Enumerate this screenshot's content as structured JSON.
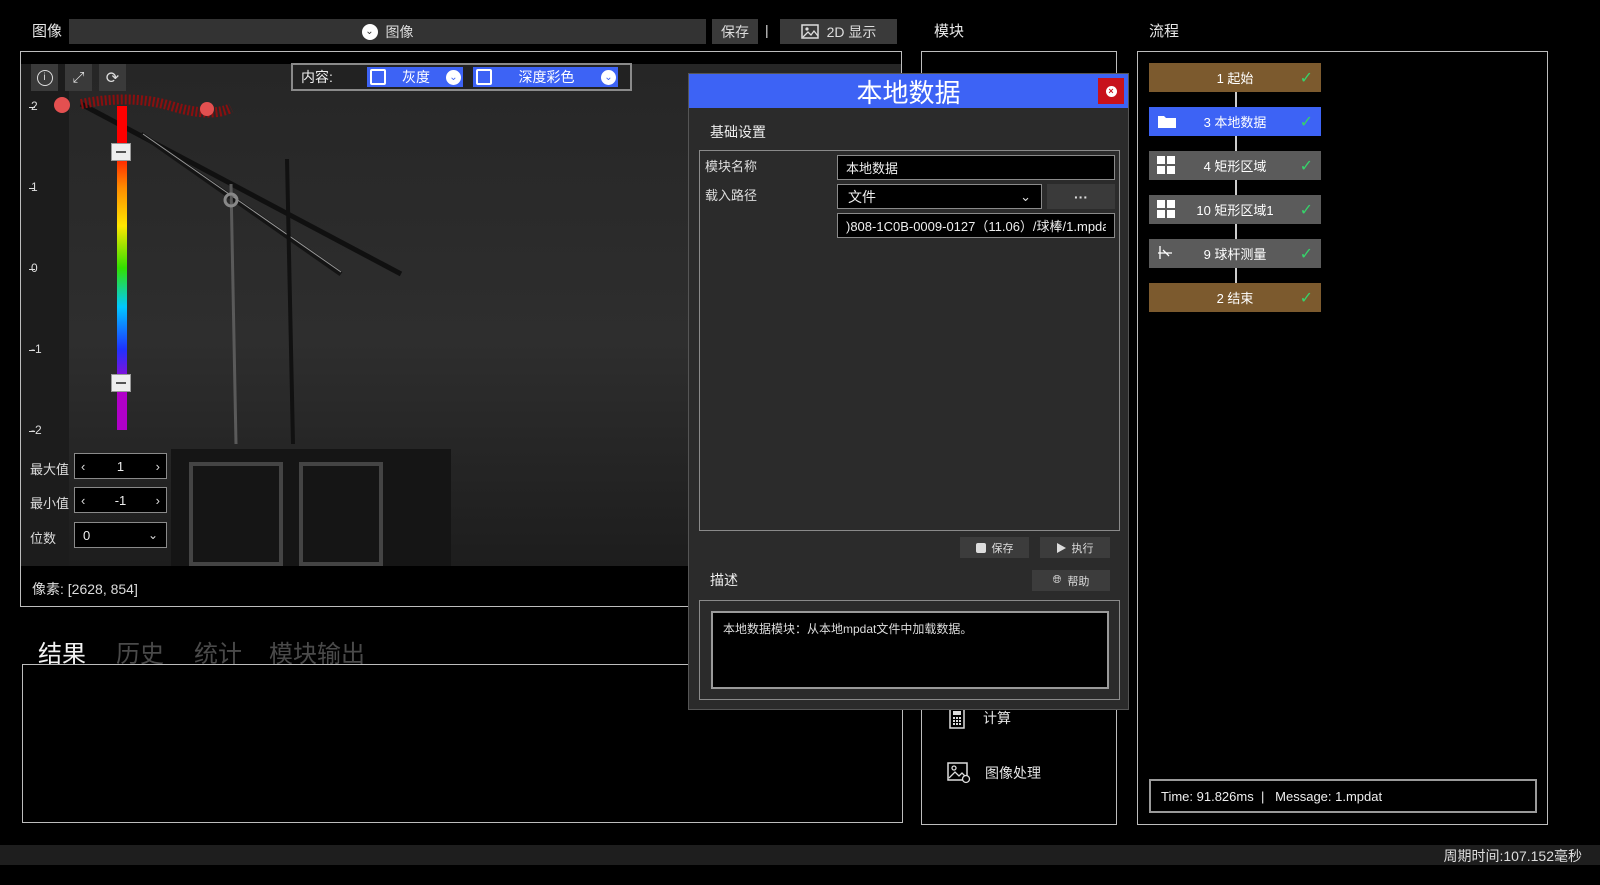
{
  "image_header": {
    "title": "图像",
    "source_select": "图像",
    "save": "保存",
    "separator": "|",
    "display_mode": "2D 显示"
  },
  "module_header": {
    "title": "模块"
  },
  "flow_header": {
    "title": "流程"
  },
  "viewer": {
    "content_label": "内容:",
    "gray_option": "灰度",
    "depth_option": "深度彩色",
    "scale_ticks": [
      "2",
      "1",
      "0",
      "-1",
      "-2"
    ],
    "max_label": "最大值",
    "max_value": "1",
    "min_label": "最小值",
    "min_value": "-1",
    "digits_label": "位数",
    "digits_value": "0",
    "pixel_info": "像素: [2628, 854]"
  },
  "tabs": [
    "结果",
    "历史",
    "统计",
    "模块输出"
  ],
  "dialog": {
    "title": "本地数据",
    "section_basic": "基础设置",
    "module_name_label": "模块名称",
    "module_name_value": "本地数据",
    "load_path_label": "载入路径",
    "load_source": "文件",
    "browse": "···",
    "path_value": ")808-1C0B-0009-0127（11.06）/球棒/1.mpdat",
    "save": "保存",
    "run": "执行",
    "section_desc": "描述",
    "help": "帮助",
    "description": "本地数据模块：从本地mpdat文件中加载数据。"
  },
  "modules": [
    {
      "label": "计算",
      "icon": "calculator-icon"
    },
    {
      "label": "图像处理",
      "icon": "image-processing-icon"
    }
  ],
  "flow": {
    "nodes": [
      {
        "label": "1 起始",
        "kind": "start",
        "status": "ok"
      },
      {
        "label": "3 本地数据",
        "kind": "selected",
        "status": "ok"
      },
      {
        "label": "4 矩形区域",
        "kind": "module",
        "status": "ok"
      },
      {
        "label": "10 矩形区域1",
        "kind": "module",
        "status": "ok"
      },
      {
        "label": "9 球杆测量",
        "kind": "module",
        "status": "ok"
      },
      {
        "label": "2 结束",
        "kind": "end",
        "status": "ok"
      }
    ],
    "status_bar": "Time: 91.826ms  |   Message: 1.mpdat"
  },
  "footer": {
    "cycle_time": "周期时间:107.152毫秒"
  },
  "colors": {
    "accent_blue": "#3d63f5",
    "node_brown": "#7c5a2e",
    "node_gray": "#5b5b5b",
    "check_green": "#36d36a",
    "close_red": "#c8121c"
  }
}
